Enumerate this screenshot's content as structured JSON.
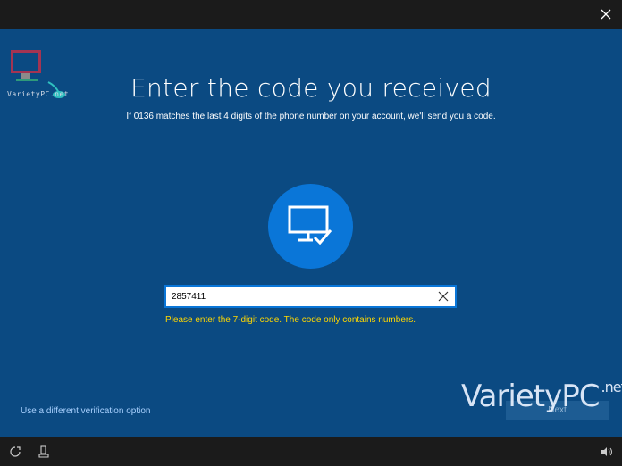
{
  "header": {
    "close_icon": "close-icon"
  },
  "branding": {
    "small_logo_text": "VarietyPC.net",
    "watermark_main": "VarietyPC",
    "watermark_suffix": ".net"
  },
  "main": {
    "title": "Enter the code you received",
    "subtitle": "If 0136 matches the last 4 digits of the phone number on your account, we'll send you a code.",
    "device_icon": "monitor-check-icon",
    "code_input": {
      "value": "2857411",
      "placeholder": ""
    },
    "error_text": "Please enter the 7-digit code. The code only contains numbers.",
    "alternate_link": "Use a different verification option",
    "next_button": "Next"
  },
  "taskbar": {
    "left_icons": [
      "ease-of-access-icon",
      "input-icon"
    ],
    "right_icons": [
      "volume-icon"
    ]
  },
  "colors": {
    "background": "#0b4a82",
    "accent": "#0a76d8",
    "error": "#ffd700",
    "link": "#a9d1ff"
  }
}
